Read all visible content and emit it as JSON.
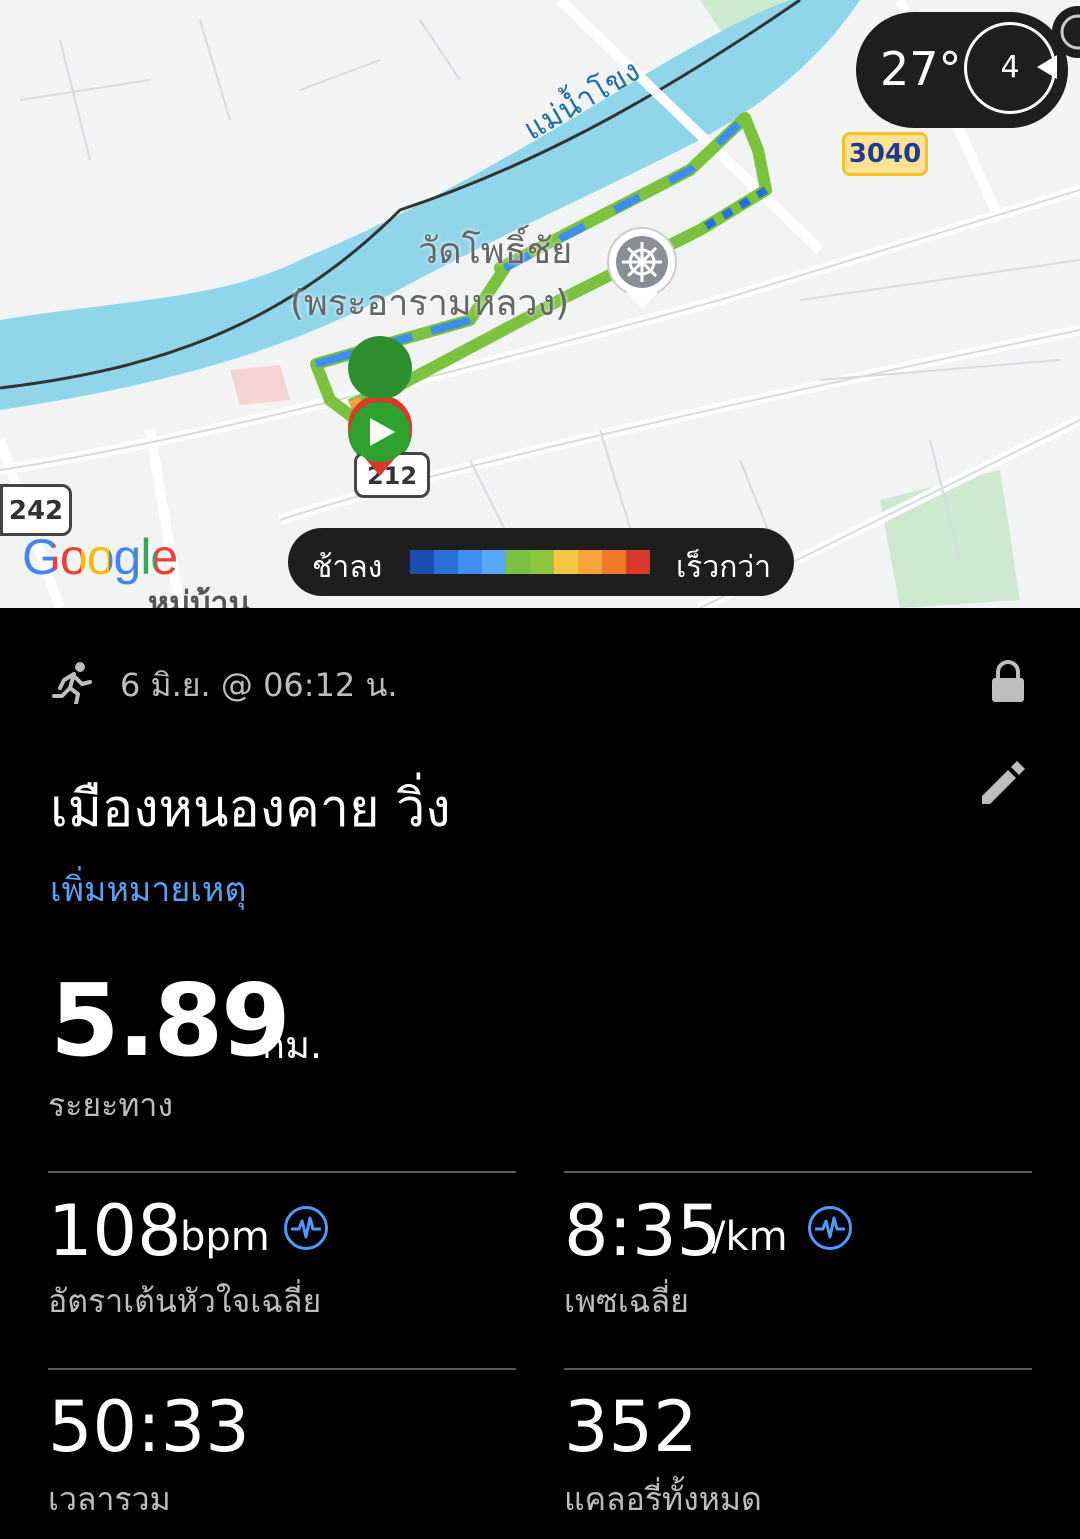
{
  "map": {
    "river_label": "แม่น้ำโขง",
    "poi_name_line1": "วัดโพธิ์ชัย",
    "poi_name_line2": "(พระอารามหลวง)",
    "road_3040": "3040",
    "road_242": "242",
    "road_212": "212",
    "area_label": "หมู่บ้าน",
    "google_logo": "Google",
    "weather": {
      "temperature": "27°",
      "compass_value": "4"
    },
    "legend": {
      "slow_label": "ช้าลง",
      "fast_label": "เร็วกว่า",
      "colors": [
        "#1a4fb0",
        "#2a6fd6",
        "#3f8ef0",
        "#59a8f5",
        "#7ac143",
        "#8cc63f",
        "#f6c544",
        "#f5a23a",
        "#f07a28",
        "#d93a2b"
      ]
    }
  },
  "activity": {
    "datetime": "6 มิ.ย. @ 06:12 น.",
    "title": "เมืองหนองคาย วิ่ง",
    "add_note": "เพิ่มหมายเหตุ",
    "distance_value": "5.89",
    "distance_unit": "กม.",
    "distance_label": "ระยะทาง",
    "stats": {
      "heart_rate_value": "108",
      "heart_rate_unit": "bpm",
      "heart_rate_label": "อัตราเต้นหัวใจเฉลี่ย",
      "pace_value": "8:35",
      "pace_unit": "/km",
      "pace_label": "เพซเฉลี่ย",
      "total_time_value": "50:33",
      "total_time_label": "เวลารวม",
      "calories_value": "352",
      "calories_label": "แคลอรี่ทั้งหมด"
    }
  },
  "colors": {
    "accent_blue": "#4e9bff",
    "link_blue": "#5aa1f5",
    "background": "#000000"
  }
}
